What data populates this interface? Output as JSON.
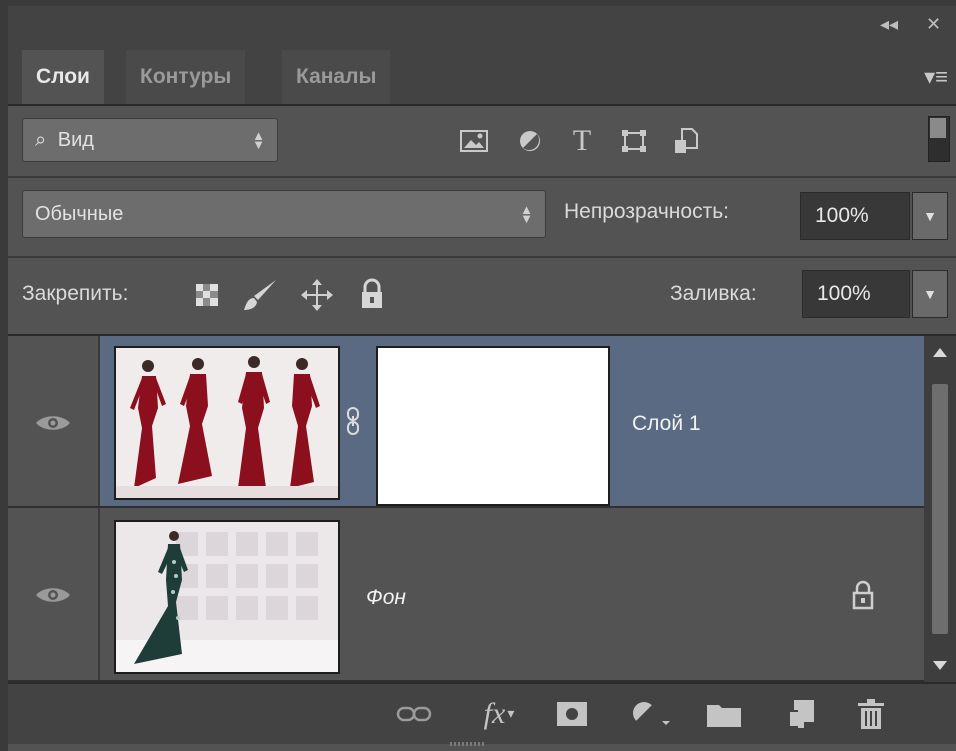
{
  "window": {
    "collapse_glyph": "◂◂",
    "close_glyph": "✕"
  },
  "tabs": [
    {
      "label": "Слои",
      "active": true
    },
    {
      "label": "Контуры",
      "active": false
    },
    {
      "label": "Каналы",
      "active": false
    }
  ],
  "panel_menu_glyph": "▾≡",
  "filter": {
    "kind_label": "Вид",
    "search_glyph": "⌕",
    "icons": [
      "image-filter-icon",
      "adjustment-filter-icon",
      "type-filter-icon",
      "shape-filter-icon",
      "smart-object-filter-icon"
    ],
    "type_glyph": "T"
  },
  "blend": {
    "mode": "Обычные",
    "opacity_label": "Непрозрачность:",
    "opacity_value": "100%"
  },
  "lock": {
    "label": "Закрепить:",
    "fill_label": "Заливка:",
    "fill_value": "100%",
    "icons": [
      "lock-transparent-pixels-icon",
      "lock-image-pixels-icon",
      "lock-position-icon",
      "lock-all-icon"
    ]
  },
  "layers": [
    {
      "name": "Слой 1",
      "selected": true,
      "visible": true,
      "has_mask": true,
      "locked": false
    },
    {
      "name": "Фон",
      "selected": false,
      "visible": true,
      "has_mask": false,
      "locked": true
    }
  ],
  "bottom_icons": [
    "link-layers-icon",
    "fx-icon",
    "add-mask-icon",
    "adjustment-layer-icon",
    "group-folder-icon",
    "new-layer-icon",
    "trash-icon"
  ],
  "fx_label": "fx",
  "colors": {
    "panel_bg": "#535353",
    "selected_layer": "#5a6a82",
    "dress_red": "#8c0f1e",
    "dress_green": "#1f3d38"
  }
}
